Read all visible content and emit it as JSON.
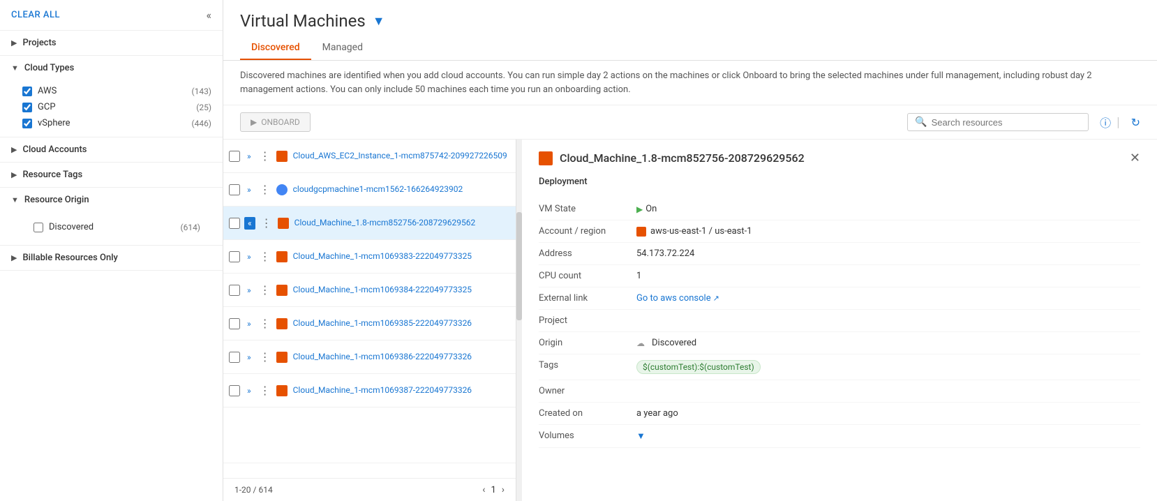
{
  "sidebar": {
    "clear_all_label": "CLEAR ALL",
    "collapse_icon": "«",
    "sections": [
      {
        "id": "projects",
        "label": "Projects",
        "expanded": false,
        "icon": "▶"
      },
      {
        "id": "cloud-types",
        "label": "Cloud Types",
        "expanded": true,
        "icon": "▼",
        "items": [
          {
            "label": "AWS",
            "count": "(143)",
            "checked": true
          },
          {
            "label": "GCP",
            "count": "(25)",
            "checked": true
          },
          {
            "label": "vSphere",
            "count": "(446)",
            "checked": true
          }
        ]
      },
      {
        "id": "cloud-accounts",
        "label": "Cloud Accounts",
        "expanded": false,
        "icon": "▶"
      },
      {
        "id": "resource-tags",
        "label": "Resource Tags",
        "expanded": false,
        "icon": "▶"
      },
      {
        "id": "resource-origin",
        "label": "Resource Origin",
        "expanded": true,
        "icon": "▼"
      }
    ],
    "discovered_label": "Discovered",
    "discovered_count": "(614)",
    "billable_label": "Billable Resources Only",
    "billable_icon": "▶"
  },
  "main": {
    "page_title": "Virtual Machines",
    "filter_icon": "▼",
    "tabs": [
      {
        "label": "Discovered",
        "active": true
      },
      {
        "label": "Managed",
        "active": false
      }
    ],
    "description": "Discovered machines are identified when you add cloud accounts. You can run simple day 2 actions on the machines or click Onboard to bring the selected machines under full management, including robust day 2 management actions. You can only include 50 machines each time you run an onboarding action.",
    "toolbar": {
      "onboard_label": "ONBOARD",
      "search_placeholder": "Search resources"
    },
    "table": {
      "footer_range": "1-20 / 614",
      "page": "1",
      "rows": [
        {
          "id": 1,
          "name": "Cloud_AWS_EC2_Instance_1-mcm875742-209927226509",
          "icon_type": "aws",
          "selected": false
        },
        {
          "id": 2,
          "name": "cloudgcpmachine1-mcm1562-166264923902",
          "icon_type": "gcp",
          "selected": false
        },
        {
          "id": 3,
          "name": "Cloud_Machine_1.8-mcm852756-208729629562",
          "icon_type": "aws",
          "selected": true
        },
        {
          "id": 4,
          "name": "Cloud_Machine_1-mcm1069383-222049773325",
          "icon_type": "aws",
          "selected": false
        },
        {
          "id": 5,
          "name": "Cloud_Machine_1-mcm1069384-222049773325",
          "icon_type": "aws",
          "selected": false
        },
        {
          "id": 6,
          "name": "Cloud_Machine_1-mcm1069385-222049773326",
          "icon_type": "aws",
          "selected": false
        },
        {
          "id": 7,
          "name": "Cloud_Machine_1-mcm1069386-222049773326",
          "icon_type": "aws",
          "selected": false
        },
        {
          "id": 8,
          "name": "Cloud_Machine_1-mcm1069387-222049773326",
          "icon_type": "aws",
          "selected": false
        }
      ]
    },
    "detail": {
      "title": "Cloud_Machine_1.8-mcm852756-208729629562",
      "section_label": "Deployment",
      "fields": [
        {
          "label": "VM State",
          "value": "On",
          "type": "vm-state"
        },
        {
          "label": "Account / region",
          "value": "aws-us-east-1 / us-east-1",
          "type": "account"
        },
        {
          "label": "Address",
          "value": "54.173.72.224",
          "type": "text"
        },
        {
          "label": "CPU count",
          "value": "1",
          "type": "text"
        },
        {
          "label": "External link",
          "value": "Go to aws console",
          "type": "link"
        },
        {
          "label": "Project",
          "value": "",
          "type": "text"
        },
        {
          "label": "Origin",
          "value": "Discovered",
          "type": "origin"
        },
        {
          "label": "Tags",
          "value": "$(customTest):$(customTest)",
          "type": "tag"
        },
        {
          "label": "Owner",
          "value": "",
          "type": "text"
        },
        {
          "label": "Created on",
          "value": "a year ago",
          "type": "text"
        },
        {
          "label": "Volumes",
          "value": "",
          "type": "expand"
        }
      ]
    }
  }
}
